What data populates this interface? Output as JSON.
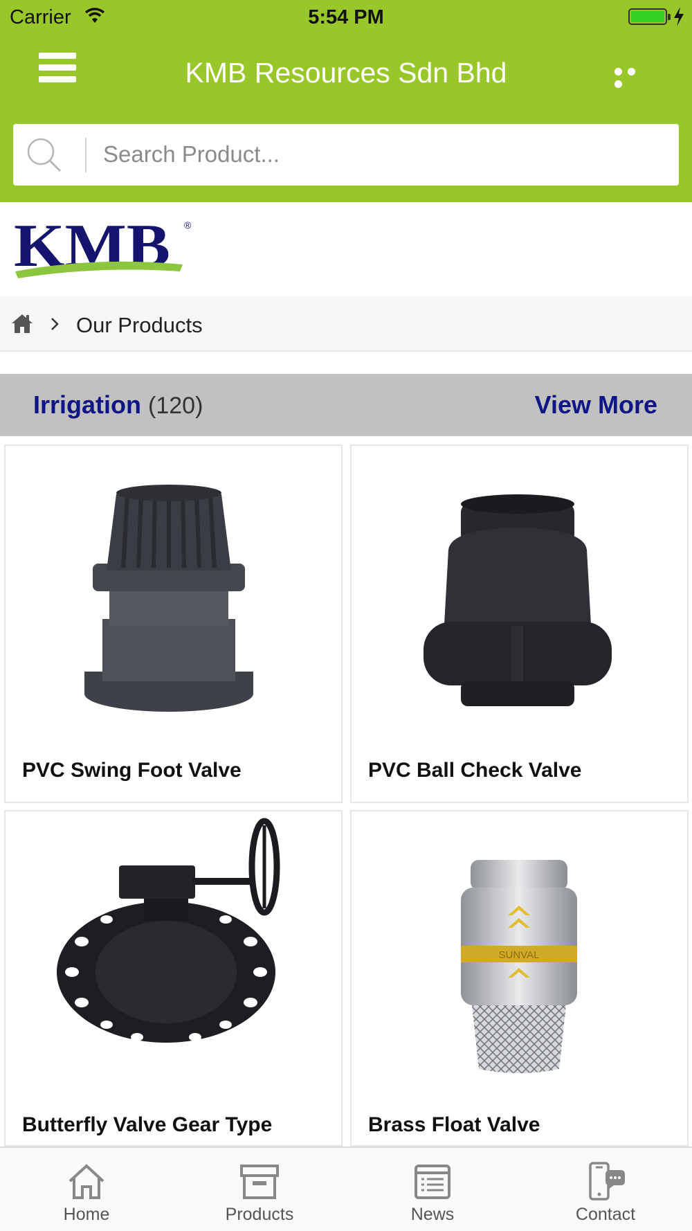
{
  "status_bar": {
    "carrier": "Carrier",
    "time": "5:54 PM"
  },
  "navbar": {
    "title": "KMB Resources Sdn Bhd",
    "menu_icon": "hamburger-icon",
    "more_icon": "more-dots-icon"
  },
  "search": {
    "placeholder": "Search Product...",
    "value": "",
    "icon": "search-icon"
  },
  "logo": {
    "text": "KMB",
    "mark": "®"
  },
  "breadcrumb": {
    "home_icon": "home-icon",
    "current": "Our Products"
  },
  "category": {
    "name": "Irrigation",
    "count": "(120)",
    "view_more": "View More"
  },
  "products": [
    {
      "name": "PVC Swing Foot Valve"
    },
    {
      "name": "PVC Ball Check Valve"
    },
    {
      "name": "Butterfly Valve Gear Type"
    },
    {
      "name": "Brass Float Valve",
      "brand_mark": "SUNVAL"
    }
  ],
  "tabs": [
    {
      "label": "Home",
      "icon": "home-icon"
    },
    {
      "label": "Products",
      "icon": "archive-box-icon"
    },
    {
      "label": "News",
      "icon": "newspaper-icon"
    },
    {
      "label": "Contact",
      "icon": "phone-chat-icon"
    }
  ],
  "colors": {
    "header": "#99c72a",
    "accent_navy": "#101585",
    "category_bar": "#c1c1c1",
    "logo_green": "#8cc63f"
  }
}
